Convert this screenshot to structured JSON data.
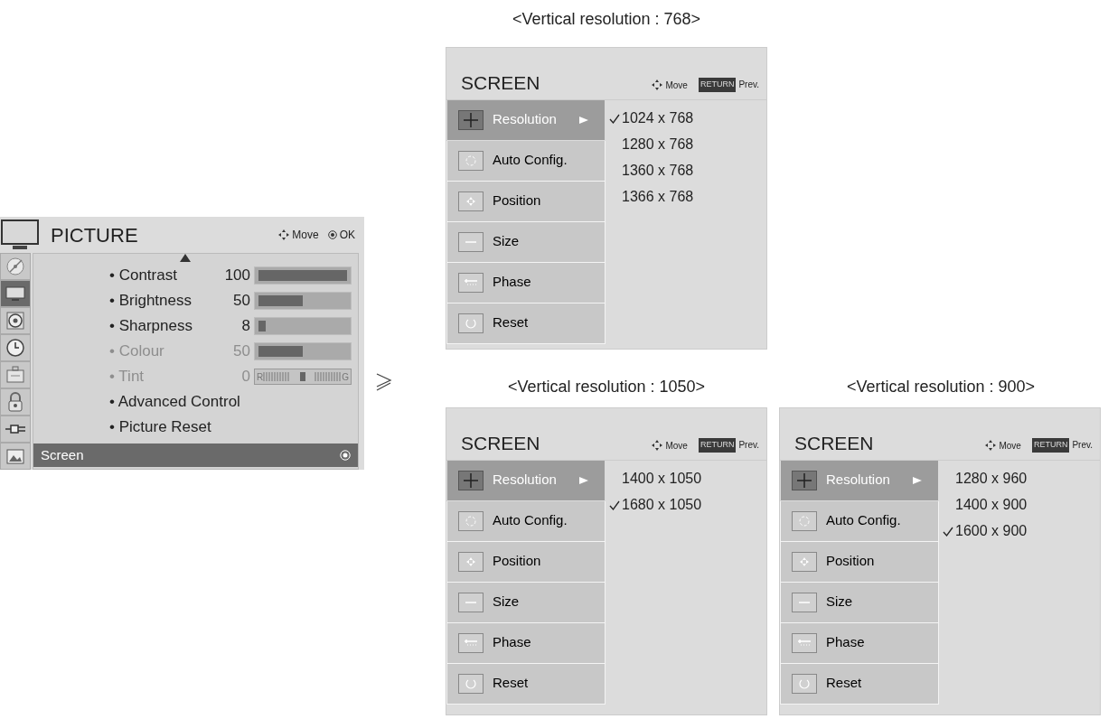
{
  "picture_menu": {
    "title": "PICTURE",
    "hints": [
      {
        "kind": "move",
        "label": "Move"
      },
      {
        "kind": "ok",
        "label": "OK"
      }
    ],
    "tabs": [
      {
        "kind": "satellite",
        "selected": false
      },
      {
        "kind": "tv",
        "selected": true
      },
      {
        "kind": "speaker",
        "selected": false
      },
      {
        "kind": "clock",
        "selected": false
      },
      {
        "kind": "toolbox",
        "selected": false
      },
      {
        "kind": "lock",
        "selected": false
      },
      {
        "kind": "plug",
        "selected": false
      },
      {
        "kind": "photo",
        "selected": false
      }
    ],
    "items": [
      {
        "kind": "bar",
        "label": "• Contrast",
        "value": "100",
        "level": 1.0,
        "disabled": false
      },
      {
        "kind": "bar",
        "label": "• Brightness",
        "value": "50",
        "level": 0.5,
        "disabled": false
      },
      {
        "kind": "bar",
        "label": "• Sharpness",
        "value": "8",
        "level": 0.08,
        "disabled": false
      },
      {
        "kind": "bar",
        "label": "• Colour",
        "value": "50",
        "level": 0.5,
        "disabled": true
      },
      {
        "kind": "tint",
        "label": "• Tint",
        "value": "0",
        "level": 0.5,
        "left": "R",
        "right": "G",
        "disabled": true
      },
      {
        "kind": "link",
        "label": "• Advanced Control",
        "disabled": false
      },
      {
        "kind": "link",
        "label": "• Picture Reset",
        "disabled": false
      }
    ],
    "footer": {
      "label": "Screen",
      "selected": true
    }
  },
  "screens": [
    {
      "caption": "<Vertical resolution : 768>",
      "title": "SCREEN",
      "move": "Move",
      "key": "RETURN",
      "prev": "Prev.",
      "items": [
        {
          "kind": "resolution",
          "label": "Resolution",
          "selected": true
        },
        {
          "kind": "auto",
          "label": "Auto Config.",
          "selected": false
        },
        {
          "kind": "position",
          "label": "Position",
          "selected": false
        },
        {
          "kind": "size",
          "label": "Size",
          "selected": false
        },
        {
          "kind": "phase",
          "label": "Phase",
          "selected": false
        },
        {
          "kind": "reset",
          "label": "Reset",
          "selected": false
        }
      ],
      "options": [
        {
          "label": "1024 x 768",
          "checked": true
        },
        {
          "label": "1280 x 768",
          "checked": false
        },
        {
          "label": "1360 x 768",
          "checked": false
        },
        {
          "label": "1366 x 768",
          "checked": false
        }
      ]
    },
    {
      "caption": "<Vertical resolution : 1050>",
      "title": "SCREEN",
      "move": "Move",
      "key": "RETURN",
      "prev": "Prev.",
      "items": [
        {
          "kind": "resolution",
          "label": "Resolution",
          "selected": true
        },
        {
          "kind": "auto",
          "label": "Auto Config.",
          "selected": false
        },
        {
          "kind": "position",
          "label": "Position",
          "selected": false
        },
        {
          "kind": "size",
          "label": "Size",
          "selected": false
        },
        {
          "kind": "phase",
          "label": "Phase",
          "selected": false
        },
        {
          "kind": "reset",
          "label": "Reset",
          "selected": false
        }
      ],
      "options": [
        {
          "label": "1400 x 1050",
          "checked": false
        },
        {
          "label": "1680 x 1050",
          "checked": true
        }
      ]
    },
    {
      "caption": "<Vertical resolution : 900>",
      "title": "SCREEN",
      "move": "Move",
      "key": "RETURN",
      "prev": "Prev.",
      "items": [
        {
          "kind": "resolution",
          "label": "Resolution",
          "selected": true
        },
        {
          "kind": "auto",
          "label": "Auto Config.",
          "selected": false
        },
        {
          "kind": "position",
          "label": "Position",
          "selected": false
        },
        {
          "kind": "size",
          "label": "Size",
          "selected": false
        },
        {
          "kind": "phase",
          "label": "Phase",
          "selected": false
        },
        {
          "kind": "reset",
          "label": "Reset",
          "selected": false
        }
      ],
      "options": [
        {
          "label": "1280 x 960",
          "checked": false
        },
        {
          "label": "1400 x 900",
          "checked": false
        },
        {
          "label": "1600 x 900",
          "checked": true
        }
      ]
    }
  ]
}
